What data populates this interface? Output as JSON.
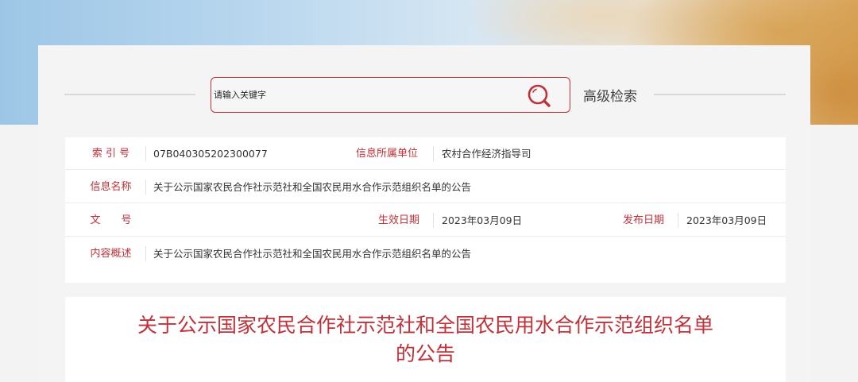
{
  "search": {
    "placeholder": "请输入关键字",
    "advanced_label": "高级检索"
  },
  "info": {
    "index_label": "索 引 号",
    "index_value": "07B040305202300077",
    "unit_label": "信息所属单位",
    "unit_value": "农村合作经济指导司",
    "name_label": "信息名称",
    "name_value": "关于公示国家农民合作社示范社和全国农民用水合作示范组织名单的公告",
    "docno_label": "文　　号",
    "docno_value": "",
    "effective_label": "生效日期",
    "effective_value": "2023年03月09日",
    "publish_label": "发布日期",
    "publish_value": "2023年03月09日",
    "summary_label": "内容概述",
    "summary_value": "关于公示国家农民合作社示范社和全国农民用水合作示范组织名单的公告"
  },
  "document": {
    "title_line1": "关于公示国家农民合作社示范社和全国农民用水合作示范组织名单",
    "title_line2": "的公告"
  },
  "colors": {
    "accent": "#c0323a",
    "panel_bg": "#f4f4f4"
  }
}
